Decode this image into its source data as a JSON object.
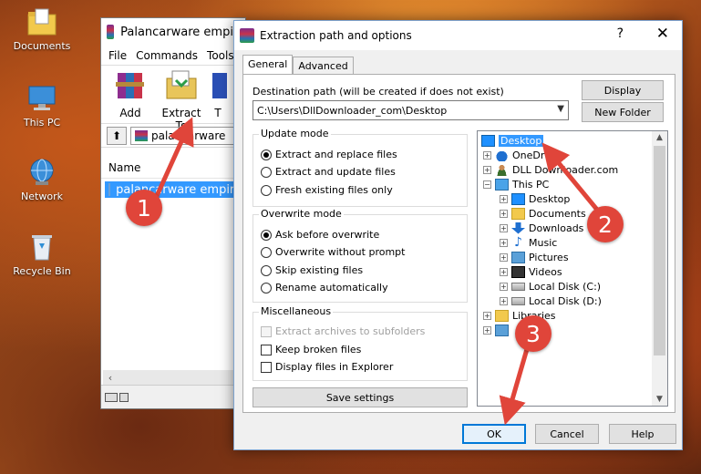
{
  "desktop": {
    "icons": [
      {
        "label": "Documents"
      },
      {
        "label": "This PC"
      },
      {
        "label": "Network"
      },
      {
        "label": "Recycle Bin"
      }
    ]
  },
  "winrar": {
    "title": "Palancarware empire",
    "menu": [
      "File",
      "Commands",
      "Tools"
    ],
    "toolbar": {
      "add": "Add",
      "extract_to": "Extract To",
      "third": "T"
    },
    "address": "palancarware",
    "column_name": "Name",
    "file_row": "palancarware empire"
  },
  "dialog": {
    "title": "Extraction path and options",
    "help": "?",
    "close": "✕",
    "tabs": {
      "general": "General",
      "advanced": "Advanced"
    },
    "destination_label": "Destination path (will be created if does not exist)",
    "destination_value": "C:\\Users\\DllDownloader_com\\Desktop",
    "display_button": "Display",
    "new_folder_button": "New Folder",
    "update_mode": {
      "title": "Update mode",
      "options": [
        "Extract and replace files",
        "Extract and update files",
        "Fresh existing files only"
      ]
    },
    "overwrite_mode": {
      "title": "Overwrite mode",
      "options": [
        "Ask before overwrite",
        "Overwrite without prompt",
        "Skip existing files",
        "Rename automatically"
      ]
    },
    "misc": {
      "title": "Miscellaneous",
      "options": [
        "Extract archives to subfolders",
        "Keep broken files",
        "Display files in Explorer"
      ]
    },
    "save_settings": "Save settings",
    "tree": {
      "nodes": [
        "Desktop",
        "OneDr",
        "DLL Downloader.com",
        "This PC",
        "Desktop",
        "Documents",
        "Downloads",
        "Music",
        "Pictures",
        "Videos",
        "Local Disk (C:)",
        "Local Disk (D:)",
        "Libraries",
        "k"
      ]
    },
    "ok": "OK",
    "cancel": "Cancel",
    "help_button": "Help"
  },
  "annotations": {
    "badges": [
      "1",
      "2",
      "3"
    ],
    "color": "#e0453a"
  }
}
